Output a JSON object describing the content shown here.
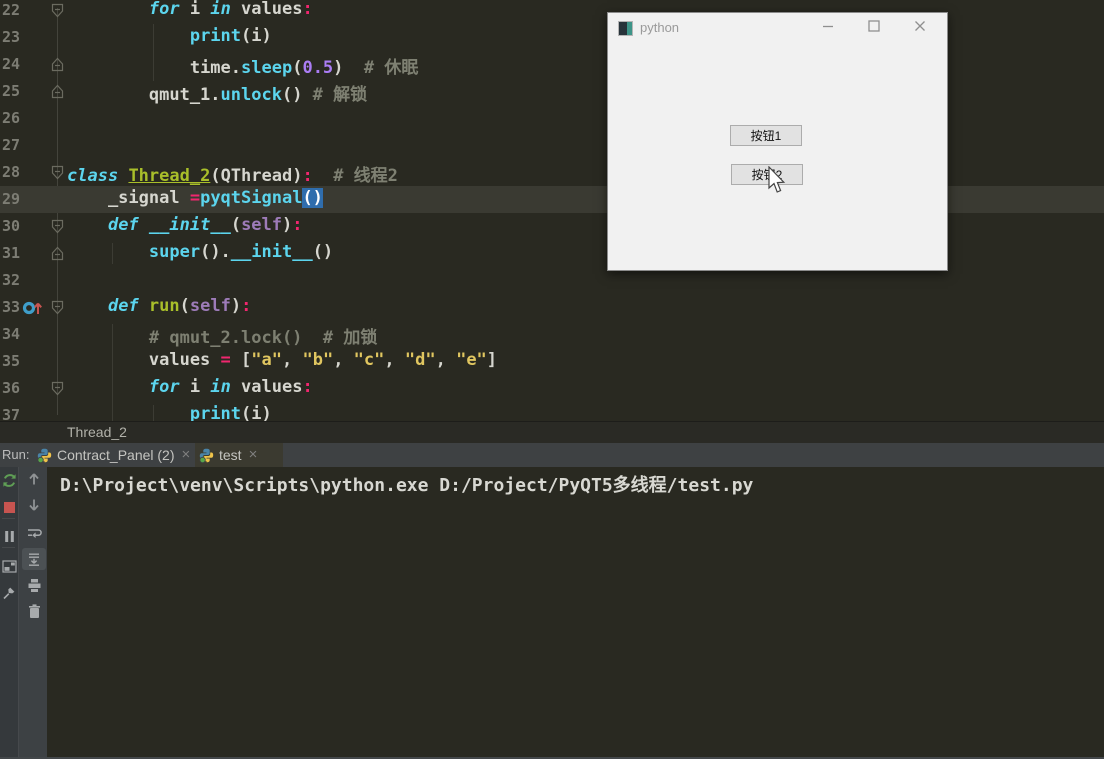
{
  "editor": {
    "lines": [
      {
        "num": "22",
        "gutter": [
          "fold-down"
        ],
        "tokens": [
          [
            "        ",
            "fg"
          ],
          [
            "for",
            "kw"
          ],
          [
            " i ",
            "fg"
          ],
          [
            "in",
            "kw"
          ],
          [
            " values",
            "fg"
          ],
          [
            ":",
            "op"
          ]
        ]
      },
      {
        "num": "23",
        "gutter": [],
        "tokens": [
          [
            "            ",
            "fg"
          ],
          [
            "print",
            "fn"
          ],
          [
            "(i)",
            "fg"
          ]
        ]
      },
      {
        "num": "24",
        "gutter": [
          "fold-up"
        ],
        "tokens": [
          [
            "            ",
            "fg"
          ],
          [
            "time.",
            "fg"
          ],
          [
            "sleep",
            "fn"
          ],
          [
            "(",
            "fg"
          ],
          [
            "0.5",
            "num"
          ],
          [
            ")",
            "fg"
          ],
          [
            "  ",
            "fg"
          ],
          [
            "# 休眠",
            "cm"
          ]
        ]
      },
      {
        "num": "25",
        "gutter": [
          "fold-up"
        ],
        "tokens": [
          [
            "        qmut_1.",
            "fg"
          ],
          [
            "unlock",
            "fn"
          ],
          [
            "() ",
            "fg"
          ],
          [
            "# 解锁",
            "cm"
          ]
        ]
      },
      {
        "num": "26",
        "gutter": [],
        "tokens": []
      },
      {
        "num": "27",
        "gutter": [],
        "tokens": []
      },
      {
        "num": "28",
        "gutter": [
          "fold-down"
        ],
        "tokens": [
          [
            "class",
            "kw"
          ],
          [
            " ",
            "fg"
          ],
          [
            "Thread_2",
            "cls"
          ],
          [
            "(QThread)",
            "fg"
          ],
          [
            ":",
            "op"
          ],
          [
            "  ",
            "fg"
          ],
          [
            "# 线程2",
            "cm"
          ]
        ]
      },
      {
        "num": "29",
        "cur": true,
        "gutter": [],
        "tokens": [
          [
            "    _signal ",
            "fg"
          ],
          [
            "=",
            "op"
          ],
          [
            "pyqtSignal",
            "fn"
          ],
          [
            "()",
            "sel"
          ]
        ]
      },
      {
        "num": "30",
        "gutter": [
          "fold-down"
        ],
        "tokens": [
          [
            "    ",
            "fg"
          ],
          [
            "def",
            "kw"
          ],
          [
            " ",
            "fg"
          ],
          [
            "__init__",
            "fni"
          ],
          [
            "(",
            "fg"
          ],
          [
            "self",
            "slf"
          ],
          [
            ")",
            "fg"
          ],
          [
            ":",
            "op"
          ]
        ]
      },
      {
        "num": "31",
        "gutter": [
          "fold-up"
        ],
        "tokens": [
          [
            "        ",
            "fg"
          ],
          [
            "super",
            "fn"
          ],
          [
            "().",
            "fg"
          ],
          [
            "__init__",
            "fn"
          ],
          [
            "()",
            "fg"
          ]
        ]
      },
      {
        "num": "32",
        "gutter": [],
        "tokens": []
      },
      {
        "num": "33",
        "gutter": [
          "override",
          "fold-down"
        ],
        "tokens": [
          [
            "    ",
            "fg"
          ],
          [
            "def",
            "kw"
          ],
          [
            " ",
            "fg"
          ],
          [
            "run",
            "mth"
          ],
          [
            "(",
            "fg"
          ],
          [
            "self",
            "slf"
          ],
          [
            ")",
            "fg"
          ],
          [
            ":",
            "op"
          ]
        ]
      },
      {
        "num": "34",
        "gutter": [],
        "tokens": [
          [
            "        ",
            "fg"
          ],
          [
            "# qmut_2.lock()  # 加锁",
            "cm"
          ]
        ]
      },
      {
        "num": "35",
        "gutter": [],
        "tokens": [
          [
            "        values ",
            "fg"
          ],
          [
            "=",
            "op"
          ],
          [
            " [",
            "fg"
          ],
          [
            "\"a\"",
            "str"
          ],
          [
            ", ",
            "fg"
          ],
          [
            "\"b\"",
            "str"
          ],
          [
            ", ",
            "fg"
          ],
          [
            "\"c\"",
            "str"
          ],
          [
            ", ",
            "fg"
          ],
          [
            "\"d\"",
            "str"
          ],
          [
            ", ",
            "fg"
          ],
          [
            "\"e\"",
            "str"
          ],
          [
            "]",
            "fg"
          ]
        ]
      },
      {
        "num": "36",
        "gutter": [
          "fold-down"
        ],
        "tokens": [
          [
            "        ",
            "fg"
          ],
          [
            "for",
            "kw"
          ],
          [
            " i ",
            "fg"
          ],
          [
            "in",
            "kw"
          ],
          [
            " values",
            "fg"
          ],
          [
            ":",
            "op"
          ]
        ]
      },
      {
        "num": "37",
        "gutter": [],
        "tokens": [
          [
            "            ",
            "fg"
          ],
          [
            "print",
            "fn"
          ],
          [
            "(i)",
            "fg"
          ]
        ]
      }
    ]
  },
  "bottom_bar": {
    "label": "Thread_2"
  },
  "run_panel": {
    "run_label": "Run:",
    "tabs": [
      {
        "label": "Contract_Panel (2)",
        "icon": "python",
        "close_icon": "close",
        "selected": false
      },
      {
        "label": "test",
        "icon": "python",
        "close_icon": "close",
        "selected": true
      }
    ],
    "toolbar_left": [
      "rerun",
      "stop",
      "pause",
      "restore-layout",
      "pin"
    ],
    "toolbar_console": [
      {
        "icon": "up",
        "active": false
      },
      {
        "icon": "down",
        "active": false
      },
      {
        "icon": "soft-wrap",
        "active": false
      },
      {
        "icon": "scroll-to-end",
        "active": true
      },
      {
        "icon": "print",
        "active": false
      },
      {
        "icon": "clear",
        "active": false
      }
    ],
    "console_line": "D:\\Project\\venv\\Scripts\\python.exe D:/Project/PyQT5多线程/test.py"
  },
  "qt_window": {
    "title": "python",
    "controls": [
      "minimize",
      "maximize",
      "close"
    ],
    "buttons": [
      {
        "label": "按钮1"
      },
      {
        "label": "按钮2"
      }
    ]
  },
  "colors": {
    "selection_blue": "#2f6dad",
    "stop_red": "#c75450",
    "rerun_green": "#5f9e55",
    "python_blue": "#4a84a8",
    "python_yellow": "#f0c44a",
    "run_dot_green": "#57a64a",
    "editor_bg": "#292921",
    "panel_bg": "#3e4143"
  }
}
